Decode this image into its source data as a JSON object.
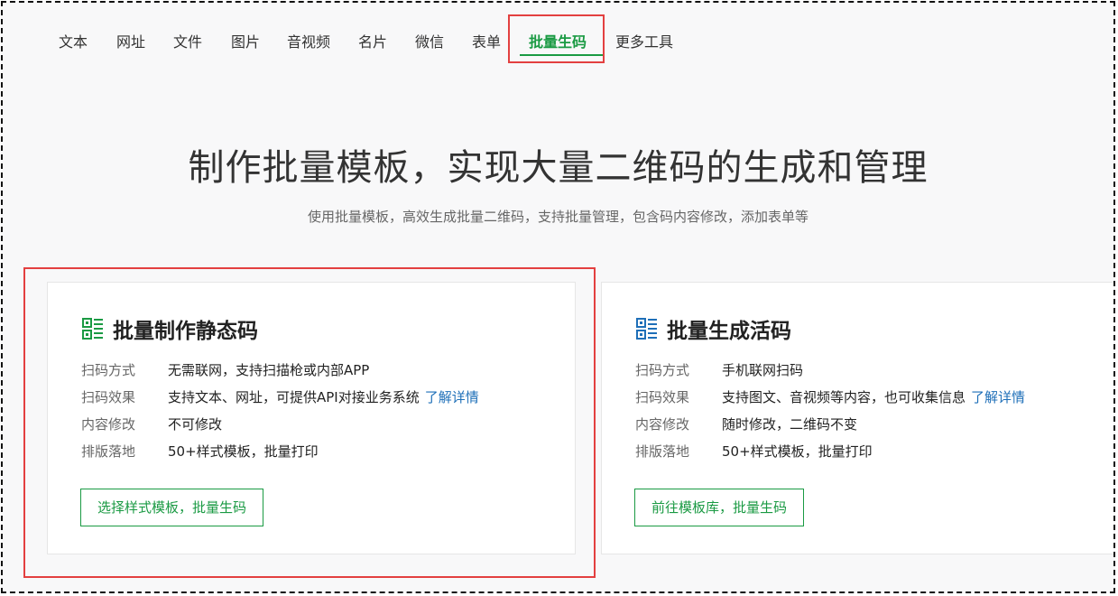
{
  "nav": {
    "items": [
      "文本",
      "网址",
      "文件",
      "图片",
      "音视频",
      "名片",
      "微信",
      "表单",
      "批量生码",
      "更多工具"
    ],
    "active": "批量生码"
  },
  "hero": {
    "title": "制作批量模板，实现大量二维码的生成和管理",
    "subtitle": "使用批量模板，高效生成批量二维码，支持批量管理，包含码内容修改，添加表单等"
  },
  "cards": [
    {
      "icon": "qr-static-icon",
      "title": "批量制作静态码",
      "rows": [
        {
          "key": "扫码方式",
          "value": "无需联网，支持扫描枪或内部APP",
          "link": ""
        },
        {
          "key": "扫码效果",
          "value": "支持文本、网址，可提供API对接业务系统",
          "link": "了解详情"
        },
        {
          "key": "内容修改",
          "value": "不可修改",
          "link": ""
        },
        {
          "key": "排版落地",
          "value": "50+样式模板，批量打印",
          "link": ""
        }
      ],
      "button": "选择样式模板，批量生码"
    },
    {
      "icon": "qr-live-icon",
      "title": "批量生成活码",
      "rows": [
        {
          "key": "扫码方式",
          "value": "手机联网扫码",
          "link": ""
        },
        {
          "key": "扫码效果",
          "value": "支持图文、音视频等内容，也可收集信息",
          "link": "了解详情"
        },
        {
          "key": "内容修改",
          "value": "随时修改，二维码不变",
          "link": ""
        },
        {
          "key": "排版落地",
          "value": "50+样式模板，批量打印",
          "link": ""
        }
      ],
      "button": "前往模板库，批量生码"
    }
  ],
  "colors": {
    "accent_green": "#1a9a43",
    "link_blue": "#1e6fb8",
    "highlight_red": "#e34040"
  }
}
